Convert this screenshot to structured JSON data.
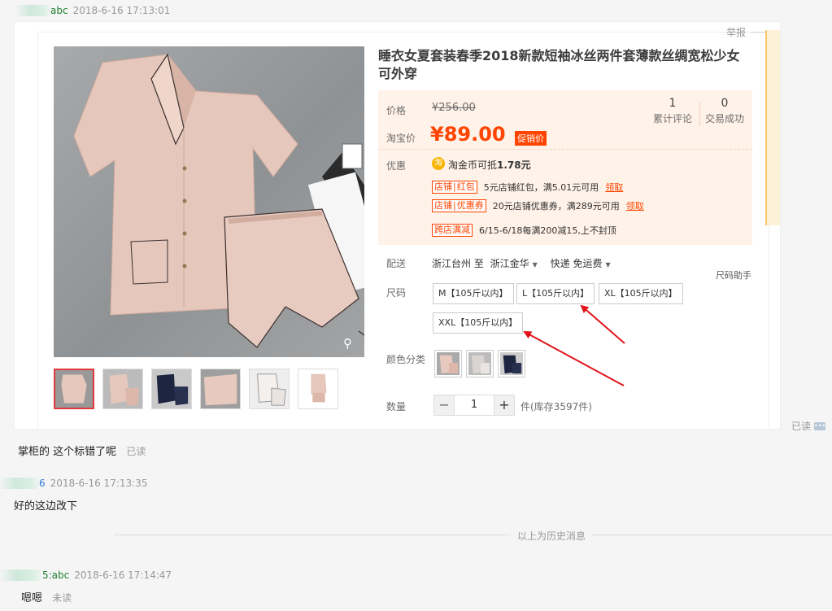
{
  "messages": [
    {
      "sender": "abc",
      "time": "2018-6-16 17:13:01"
    },
    {
      "sender": "掌柜的",
      "text": "这个标错了呢",
      "status": "已读"
    },
    {
      "sender": "6",
      "time": "2018-6-16 17:13:35",
      "text": "好的这边改下"
    },
    {
      "sender": "5:abc",
      "time": "2018-6-16 17:14:47",
      "text": "嗯嗯",
      "status": "未读"
    }
  ],
  "history_separator": "以上为历史消息",
  "side_read": "已读",
  "product": {
    "report": "举报",
    "title": "睡衣女夏套装春季2018新款短袖冰丝两件套薄款丝绸宽松少女可外穿",
    "price_label": "价格",
    "original_price": "¥256.00",
    "promo_label": "淘宝价",
    "promo_price": "¥89.00",
    "promo_tag": "促销价",
    "reviews": {
      "count": "1",
      "label": "累计评论"
    },
    "sales": {
      "count": "0",
      "label": "交易成功"
    },
    "discount_label": "优惠",
    "coin_icon": "淘",
    "coin_text": "淘金币可抵",
    "coin_amount": "1.78元",
    "coupons": [
      {
        "tag_a": "店铺",
        "tag_b": "红包",
        "desc": "5元店铺红包，满5.01元可用",
        "claim": "领取"
      },
      {
        "tag_a": "店铺",
        "tag_b": "优惠券",
        "desc": "20元店铺优惠券，满289元可用",
        "claim": "领取"
      },
      {
        "tag_a": "跨店满减",
        "desc": "6/15-6/18每满200减15,上不封顶"
      }
    ],
    "shipping_label": "配送",
    "ship_from": "浙江台州 至",
    "ship_to": "浙江金华",
    "ship_method": "快递 免运费",
    "size_label": "尺码",
    "size_helper": "尺码助手",
    "sizes": [
      "M【105斤以内】",
      "L【105斤以内】",
      "XL【105斤以内】",
      "XXL【105斤以内】"
    ],
    "color_label": "颜色分类",
    "colors": [
      "#e8c9bf",
      "#d9d3d1",
      "#1e2540"
    ],
    "quantity_label": "数量",
    "quantity": "1",
    "stock": "件(库存3597件)"
  },
  "colors": {
    "accent": "#ff4400",
    "arrow": "#e0141a",
    "price_bg": "#fff2e8"
  }
}
